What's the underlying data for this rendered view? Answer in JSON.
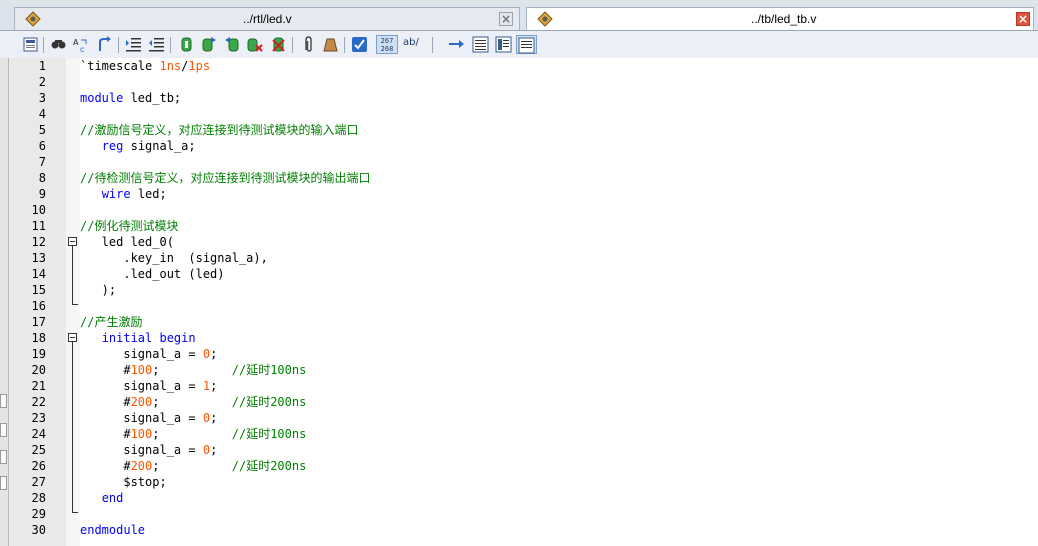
{
  "tabs": [
    {
      "label": "../rtl/led.v",
      "active": false,
      "close": "close-icon"
    },
    {
      "label": "../tb/led_tb.v",
      "active": true,
      "close": "close-icon"
    }
  ],
  "toolbar": {
    "icons": [
      "file-info-icon",
      "find-icon",
      "replace-icon",
      "goto-icon",
      "indent-icon",
      "unindent-icon",
      "bookmark-toggle-icon",
      "bookmark-next-icon",
      "bookmark-prev-icon",
      "bookmark-clear-icon",
      "bookmark-list-icon",
      "clip-icon",
      "format-icon",
      "spell-check-icon",
      "line-numbers-icon",
      "word-wrap-icon",
      "whitespace-icon",
      "jump-icon",
      "split-icon",
      "list-icon",
      "fullscreen-icon"
    ],
    "line_numbers_label": "267 268",
    "word_wrap_label": "ab/"
  },
  "lines": [
    {
      "n": "1",
      "tokens": [
        [
          "plain",
          "`timescale "
        ],
        [
          "num",
          "1ns"
        ],
        [
          "plain",
          "/"
        ],
        [
          "num",
          "1ps"
        ]
      ]
    },
    {
      "n": "2",
      "tokens": []
    },
    {
      "n": "3",
      "tokens": [
        [
          "kw",
          "module"
        ],
        [
          "plain",
          " led_tb;"
        ]
      ]
    },
    {
      "n": "4",
      "tokens": []
    },
    {
      "n": "5",
      "tokens": [
        [
          "cm",
          "//激励信号定义，对应连接到待测试模块的输入端口"
        ]
      ]
    },
    {
      "n": "6",
      "tokens": [
        [
          "plain",
          "   "
        ],
        [
          "kw",
          "reg"
        ],
        [
          "plain",
          " signal_a;"
        ]
      ]
    },
    {
      "n": "7",
      "tokens": []
    },
    {
      "n": "8",
      "tokens": [
        [
          "cm",
          "//待检测信号定义，对应连接到待测试模块的输出端口"
        ]
      ]
    },
    {
      "n": "9",
      "tokens": [
        [
          "plain",
          "   "
        ],
        [
          "kw",
          "wire"
        ],
        [
          "plain",
          " led;"
        ]
      ]
    },
    {
      "n": "10",
      "tokens": []
    },
    {
      "n": "11",
      "tokens": [
        [
          "cm",
          "//例化待测试模块"
        ]
      ]
    },
    {
      "n": "12",
      "tokens": [
        [
          "plain",
          "   led led_0("
        ]
      ]
    },
    {
      "n": "13",
      "tokens": [
        [
          "plain",
          "      .key_in  (signal_a),"
        ]
      ]
    },
    {
      "n": "14",
      "tokens": [
        [
          "plain",
          "      .led_out (led)"
        ]
      ]
    },
    {
      "n": "15",
      "tokens": [
        [
          "plain",
          "   );"
        ]
      ]
    },
    {
      "n": "16",
      "tokens": []
    },
    {
      "n": "17",
      "tokens": [
        [
          "cm",
          "//产生激励"
        ]
      ]
    },
    {
      "n": "18",
      "tokens": [
        [
          "plain",
          "   "
        ],
        [
          "kw",
          "initial begin"
        ]
      ]
    },
    {
      "n": "19",
      "tokens": [
        [
          "plain",
          "      signal_a = "
        ],
        [
          "num",
          "0"
        ],
        [
          "plain",
          ";"
        ]
      ]
    },
    {
      "n": "20",
      "tokens": [
        [
          "plain",
          "      #"
        ],
        [
          "num",
          "100"
        ],
        [
          "plain",
          ";          "
        ],
        [
          "cm",
          "//延时100ns"
        ]
      ]
    },
    {
      "n": "21",
      "tokens": [
        [
          "plain",
          "      signal_a = "
        ],
        [
          "num",
          "1"
        ],
        [
          "plain",
          ";"
        ]
      ]
    },
    {
      "n": "22",
      "tokens": [
        [
          "plain",
          "      #"
        ],
        [
          "num",
          "200"
        ],
        [
          "plain",
          ";          "
        ],
        [
          "cm",
          "//延时200ns"
        ]
      ]
    },
    {
      "n": "23",
      "tokens": [
        [
          "plain",
          "      signal_a = "
        ],
        [
          "num",
          "0"
        ],
        [
          "plain",
          ";"
        ]
      ]
    },
    {
      "n": "24",
      "tokens": [
        [
          "plain",
          "      #"
        ],
        [
          "num",
          "100"
        ],
        [
          "plain",
          ";          "
        ],
        [
          "cm",
          "//延时100ns"
        ]
      ]
    },
    {
      "n": "25",
      "tokens": [
        [
          "plain",
          "      signal_a = "
        ],
        [
          "num",
          "0"
        ],
        [
          "plain",
          ";"
        ]
      ]
    },
    {
      "n": "26",
      "tokens": [
        [
          "plain",
          "      #"
        ],
        [
          "num",
          "200"
        ],
        [
          "plain",
          ";          "
        ],
        [
          "cm",
          "//延时200ns"
        ]
      ]
    },
    {
      "n": "27",
      "tokens": [
        [
          "plain",
          "      $stop;"
        ]
      ]
    },
    {
      "n": "28",
      "tokens": [
        [
          "plain",
          "   "
        ],
        [
          "kw",
          "end"
        ]
      ]
    },
    {
      "n": "29",
      "tokens": []
    },
    {
      "n": "30",
      "tokens": [
        [
          "kw",
          "endmodule"
        ]
      ]
    }
  ],
  "colors": {
    "keyword": "#0000ff",
    "number": "#ff5500",
    "comment": "#008000",
    "gutter": "#e9e9e9"
  }
}
